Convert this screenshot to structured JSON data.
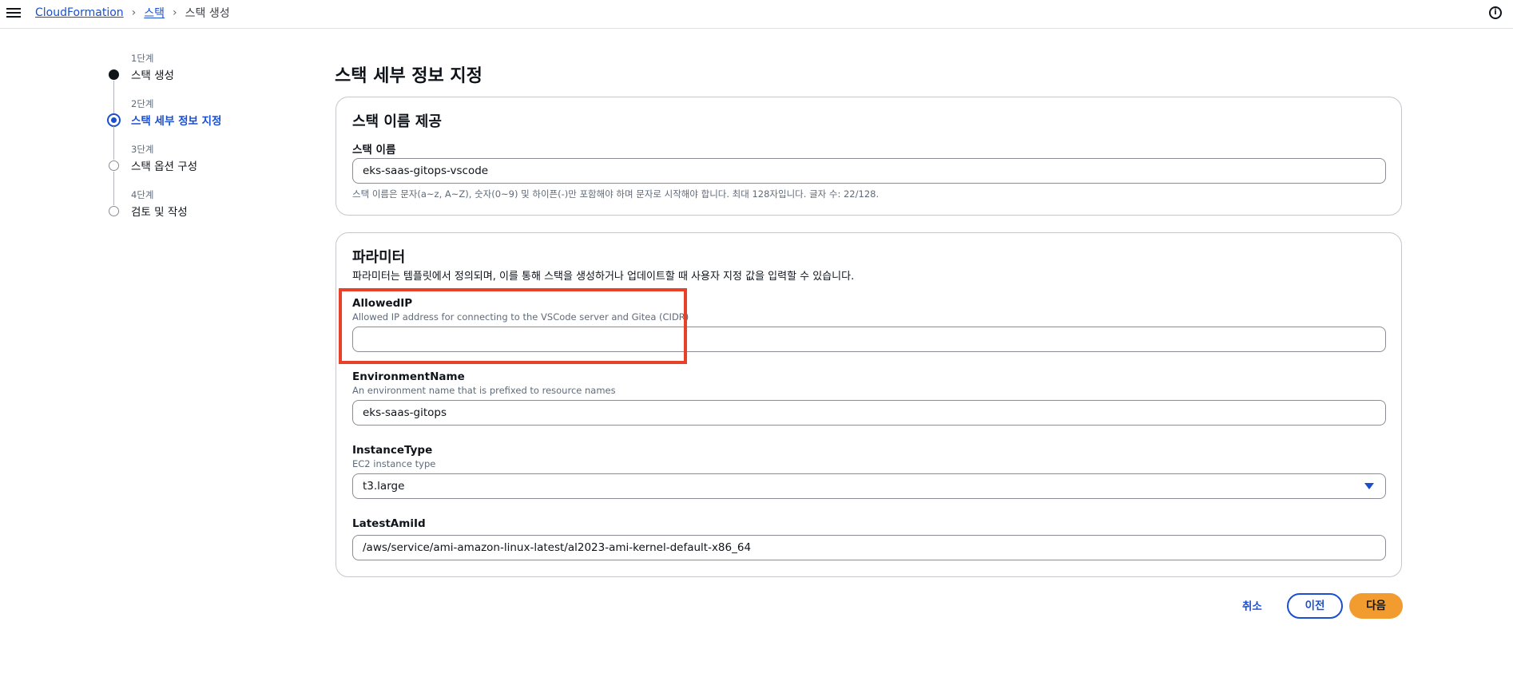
{
  "breadcrumb": {
    "root": "CloudFormation",
    "stacks": "스택",
    "current": "스택 생성"
  },
  "steps": [
    {
      "num": "1단계",
      "title": "스택 생성",
      "state": "done"
    },
    {
      "num": "2단계",
      "title": "스택 세부 정보 지정",
      "state": "active"
    },
    {
      "num": "3단계",
      "title": "스택 옵션 구성",
      "state": "pending"
    },
    {
      "num": "4단계",
      "title": "검토 및 작성",
      "state": "pending"
    }
  ],
  "page": {
    "title": "스택 세부 정보 지정"
  },
  "stack_name_card": {
    "title": "스택 이름 제공",
    "label": "스택 이름",
    "value": "eks-saas-gitops-vscode",
    "hint": "스택 이름은 문자(a~z, A~Z), 숫자(0~9) 및 하이픈(-)만 포함해야 하며 문자로 시작해야 합니다. 최대 128자입니다. 글자 수: 22/128."
  },
  "parameters_card": {
    "title": "파라미터",
    "description": "파라미터는 템플릿에서 정의되며, 이를 통해 스택을 생성하거나 업데이트할 때 사용자 지정 값을 입력할 수 있습니다.",
    "params": {
      "allowed_ip": {
        "label": "AllowedIP",
        "desc": "Allowed IP address for connecting to the VSCode server and Gitea (CIDR)",
        "value": ""
      },
      "environment_name": {
        "label": "EnvironmentName",
        "desc": "An environment name that is prefixed to resource names",
        "value": "eks-saas-gitops"
      },
      "instance_type": {
        "label": "InstanceType",
        "desc": "EC2 instance type",
        "value": "t3.large"
      },
      "latest_ami_id": {
        "label": "LatestAmiId",
        "value": "/aws/service/ami-amazon-linux-latest/al2023-ami-kernel-default-x86_64"
      }
    }
  },
  "footer": {
    "cancel": "취소",
    "previous": "이전",
    "next": "다음"
  },
  "colors": {
    "accent": "#1b4fd1",
    "primary_button": "#f29b2f",
    "highlight_box": "#e8412a"
  },
  "icons": {
    "menu": "hamburger-icon",
    "info": "info-icon",
    "select": "caret-down-icon"
  }
}
